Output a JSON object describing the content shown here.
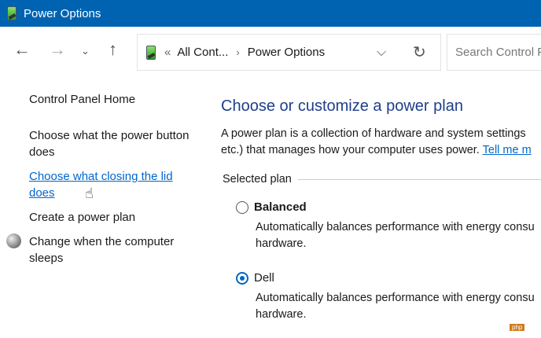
{
  "window": {
    "title": "Power Options"
  },
  "address": {
    "prefix": "«",
    "crumb1": "All Cont...",
    "sep": "›",
    "crumb2": "Power Options"
  },
  "search": {
    "placeholder": "Search Control P"
  },
  "sidebar": {
    "home": "Control Panel Home",
    "items": [
      {
        "label": "Choose what the power button does"
      },
      {
        "label": "Choose what closing the lid does"
      },
      {
        "label": "Create a power plan"
      },
      {
        "label": "Change when the computer sleeps"
      }
    ]
  },
  "main": {
    "title": "Choose or customize a power plan",
    "desc1": "A power plan is a collection of hardware and system settings",
    "desc2": "etc.) that manages how your computer uses power.",
    "tell_more": "Tell me m",
    "group": "Selected plan",
    "plans": [
      {
        "name": "Balanced",
        "selected": false,
        "desc1": "Automatically balances performance with energy consu",
        "desc2": "hardware."
      },
      {
        "name": "Dell",
        "selected": true,
        "desc1": "Automatically balances performance with energy consu",
        "desc2": "hardware."
      }
    ]
  },
  "watermark": "php",
  "colors": {
    "titlebar": "#0063b1",
    "link": "#0066cc",
    "heading": "#1e3f8a"
  }
}
